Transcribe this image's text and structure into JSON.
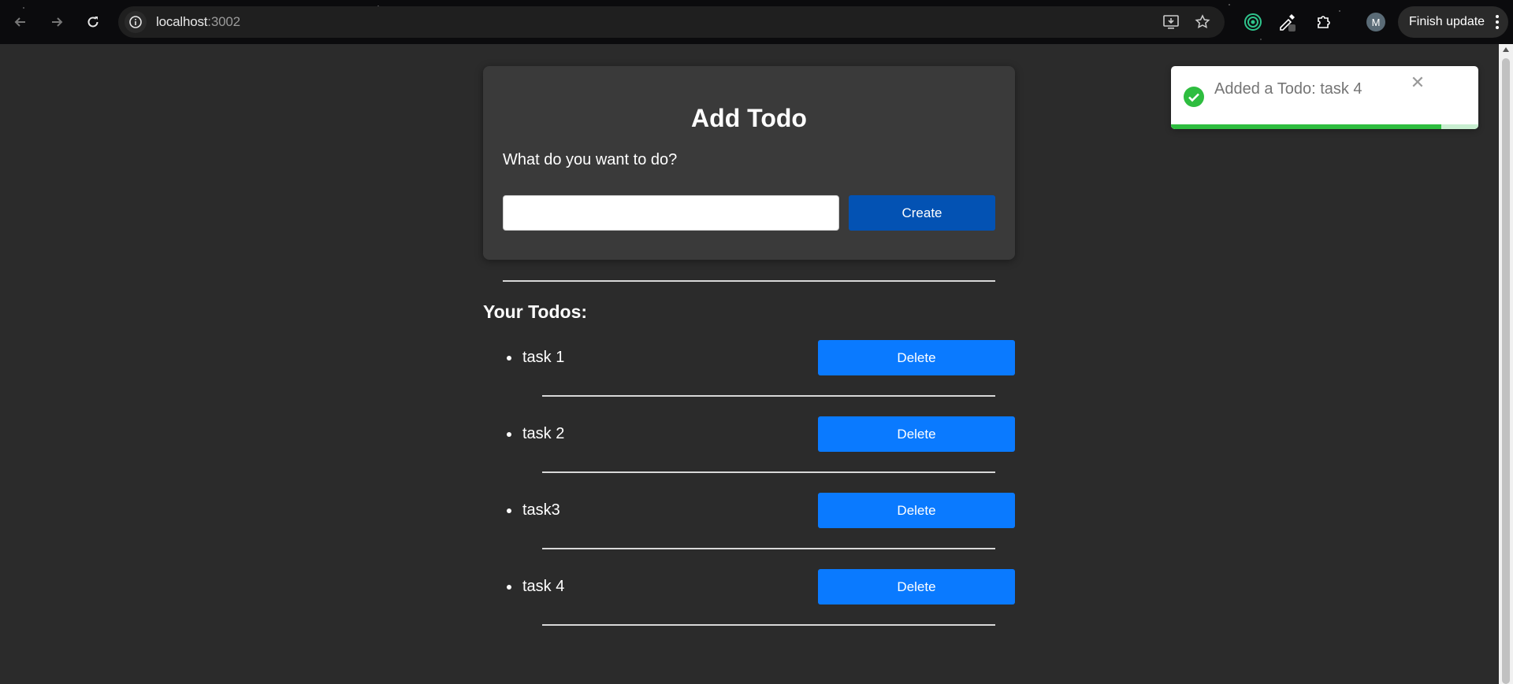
{
  "browser": {
    "url_host": "localhost",
    "url_port": ":3002",
    "profile_initial": "M",
    "finish_update_label": "Finish update",
    "icons": [
      "back-arrow-icon",
      "forward-arrow-icon",
      "reload-icon",
      "site-info-icon",
      "install-app-icon",
      "bookmark-star-icon",
      "extension-target-icon",
      "eyedropper-icon",
      "extensions-puzzle-icon",
      "more-menu-icon"
    ]
  },
  "card": {
    "title": "Add Todo",
    "label": "What do you want to do?",
    "input_value": "",
    "create_label": "Create"
  },
  "todos": {
    "heading": "Your Todos:",
    "items": [
      {
        "text": "task 1",
        "delete_label": "Delete"
      },
      {
        "text": "task 2",
        "delete_label": "Delete"
      },
      {
        "text": "task3",
        "delete_label": "Delete"
      },
      {
        "text": "task 4",
        "delete_label": "Delete"
      }
    ]
  },
  "toast": {
    "message": "Added a Todo: task 4",
    "close_label": "✕",
    "progress_fraction": 0.88,
    "accent": "#2ebd3f"
  },
  "colors": {
    "page_bg": "#2b2b2b",
    "card_bg": "#3a3a3a",
    "create_button": "#0352b3",
    "delete_button": "#0a7aff"
  }
}
